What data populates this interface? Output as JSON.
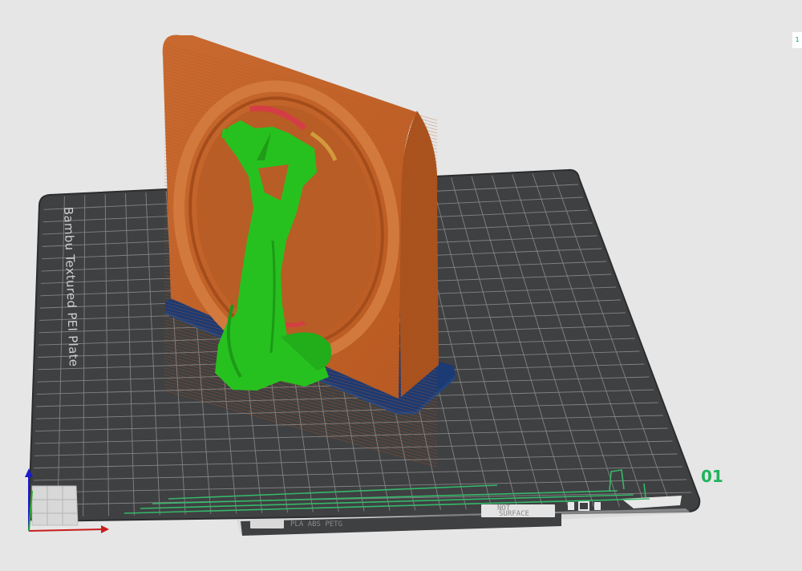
{
  "viewport": {
    "plate_label": "Bambu Textured PEI Plate",
    "plate_number": "01",
    "strip_material": "PLA ABS PETG",
    "strip_notice_line1": "NOT",
    "strip_notice_line2": "SURFACE",
    "corner_badge": "1"
  },
  "colors": {
    "background": "#e6e6e6",
    "plate": "#3f4042",
    "grid": "#9a9a9a",
    "model_orange": "#c8642a",
    "support_green": "#27c11f",
    "raft_blue": "#1c3a73",
    "accent_green": "#1fb35c"
  }
}
